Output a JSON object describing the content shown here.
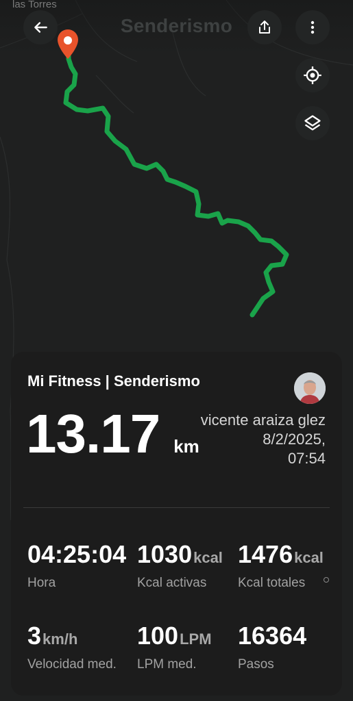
{
  "map": {
    "town_label": "las Torres"
  },
  "header": {
    "title": "Senderismo"
  },
  "card": {
    "title": "Mi Fitness | Senderismo",
    "distance": {
      "value": "13.17",
      "unit": "km"
    },
    "user": {
      "name": "vicente araiza glez",
      "date": "8/2/2025,",
      "time": "07:54"
    },
    "stats": [
      {
        "value": "04:25:04",
        "unit": "",
        "label": "Hora"
      },
      {
        "value": "1030",
        "unit": "kcal",
        "label": "Kcal activas"
      },
      {
        "value": "1476",
        "unit": "kcal",
        "label": "Kcal totales"
      },
      {
        "value": "3",
        "unit": "km/h",
        "label": "Velocidad med."
      },
      {
        "value": "100",
        "unit": "LPM",
        "label": "LPM med."
      },
      {
        "value": "16364",
        "unit": "",
        "label": "Pasos"
      }
    ]
  },
  "colors": {
    "route": "#1aa34a",
    "pin": "#e8532b",
    "background": "#1e1f1f"
  },
  "icons": [
    "back-arrow-icon",
    "share-icon",
    "more-vertical-icon",
    "locate-icon",
    "layers-icon",
    "location-pin-icon",
    "info-icon"
  ]
}
